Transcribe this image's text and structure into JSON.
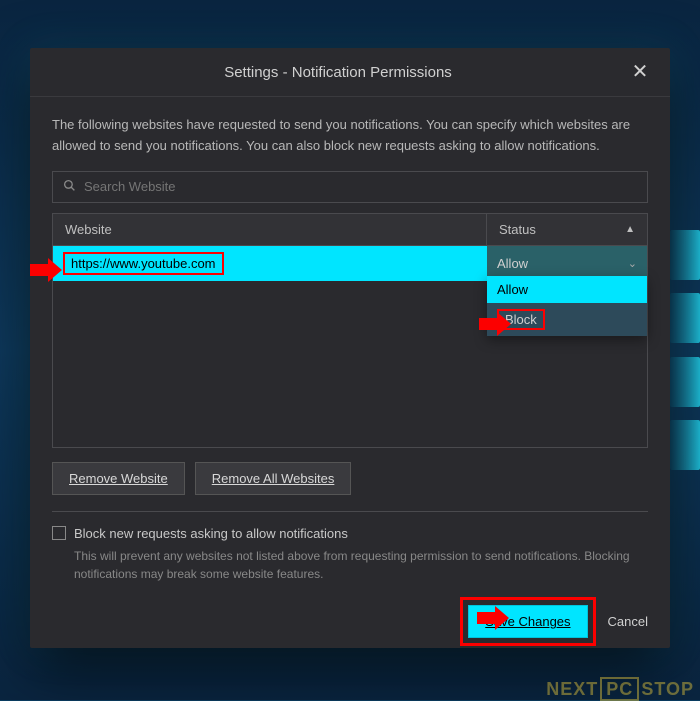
{
  "modal": {
    "title": "Settings - Notification Permissions",
    "description": "The following websites have requested to send you notifications. You can specify which websites are allowed to send you notifications. You can also block new requests asking to allow notifications.",
    "search": {
      "placeholder": "Search Website"
    },
    "table": {
      "headers": {
        "website": "Website",
        "status": "Status"
      },
      "rows": [
        {
          "url": "https://www.youtube.com",
          "status": "Allow"
        }
      ]
    },
    "dropdown": {
      "options": [
        "Allow",
        "Block"
      ]
    },
    "buttons": {
      "removeWebsite": "Remove Website",
      "removeAll": "Remove All Websites",
      "save": "Save Changes",
      "cancel": "Cancel"
    },
    "checkbox": {
      "label": "Block new requests asking to allow notifications",
      "help": "This will prevent any websites not listed above from requesting permission to send notifications. Blocking notifications may break some website features."
    }
  },
  "watermark": {
    "left": "NEXT",
    "mid": "PC",
    "right": "STOP"
  }
}
